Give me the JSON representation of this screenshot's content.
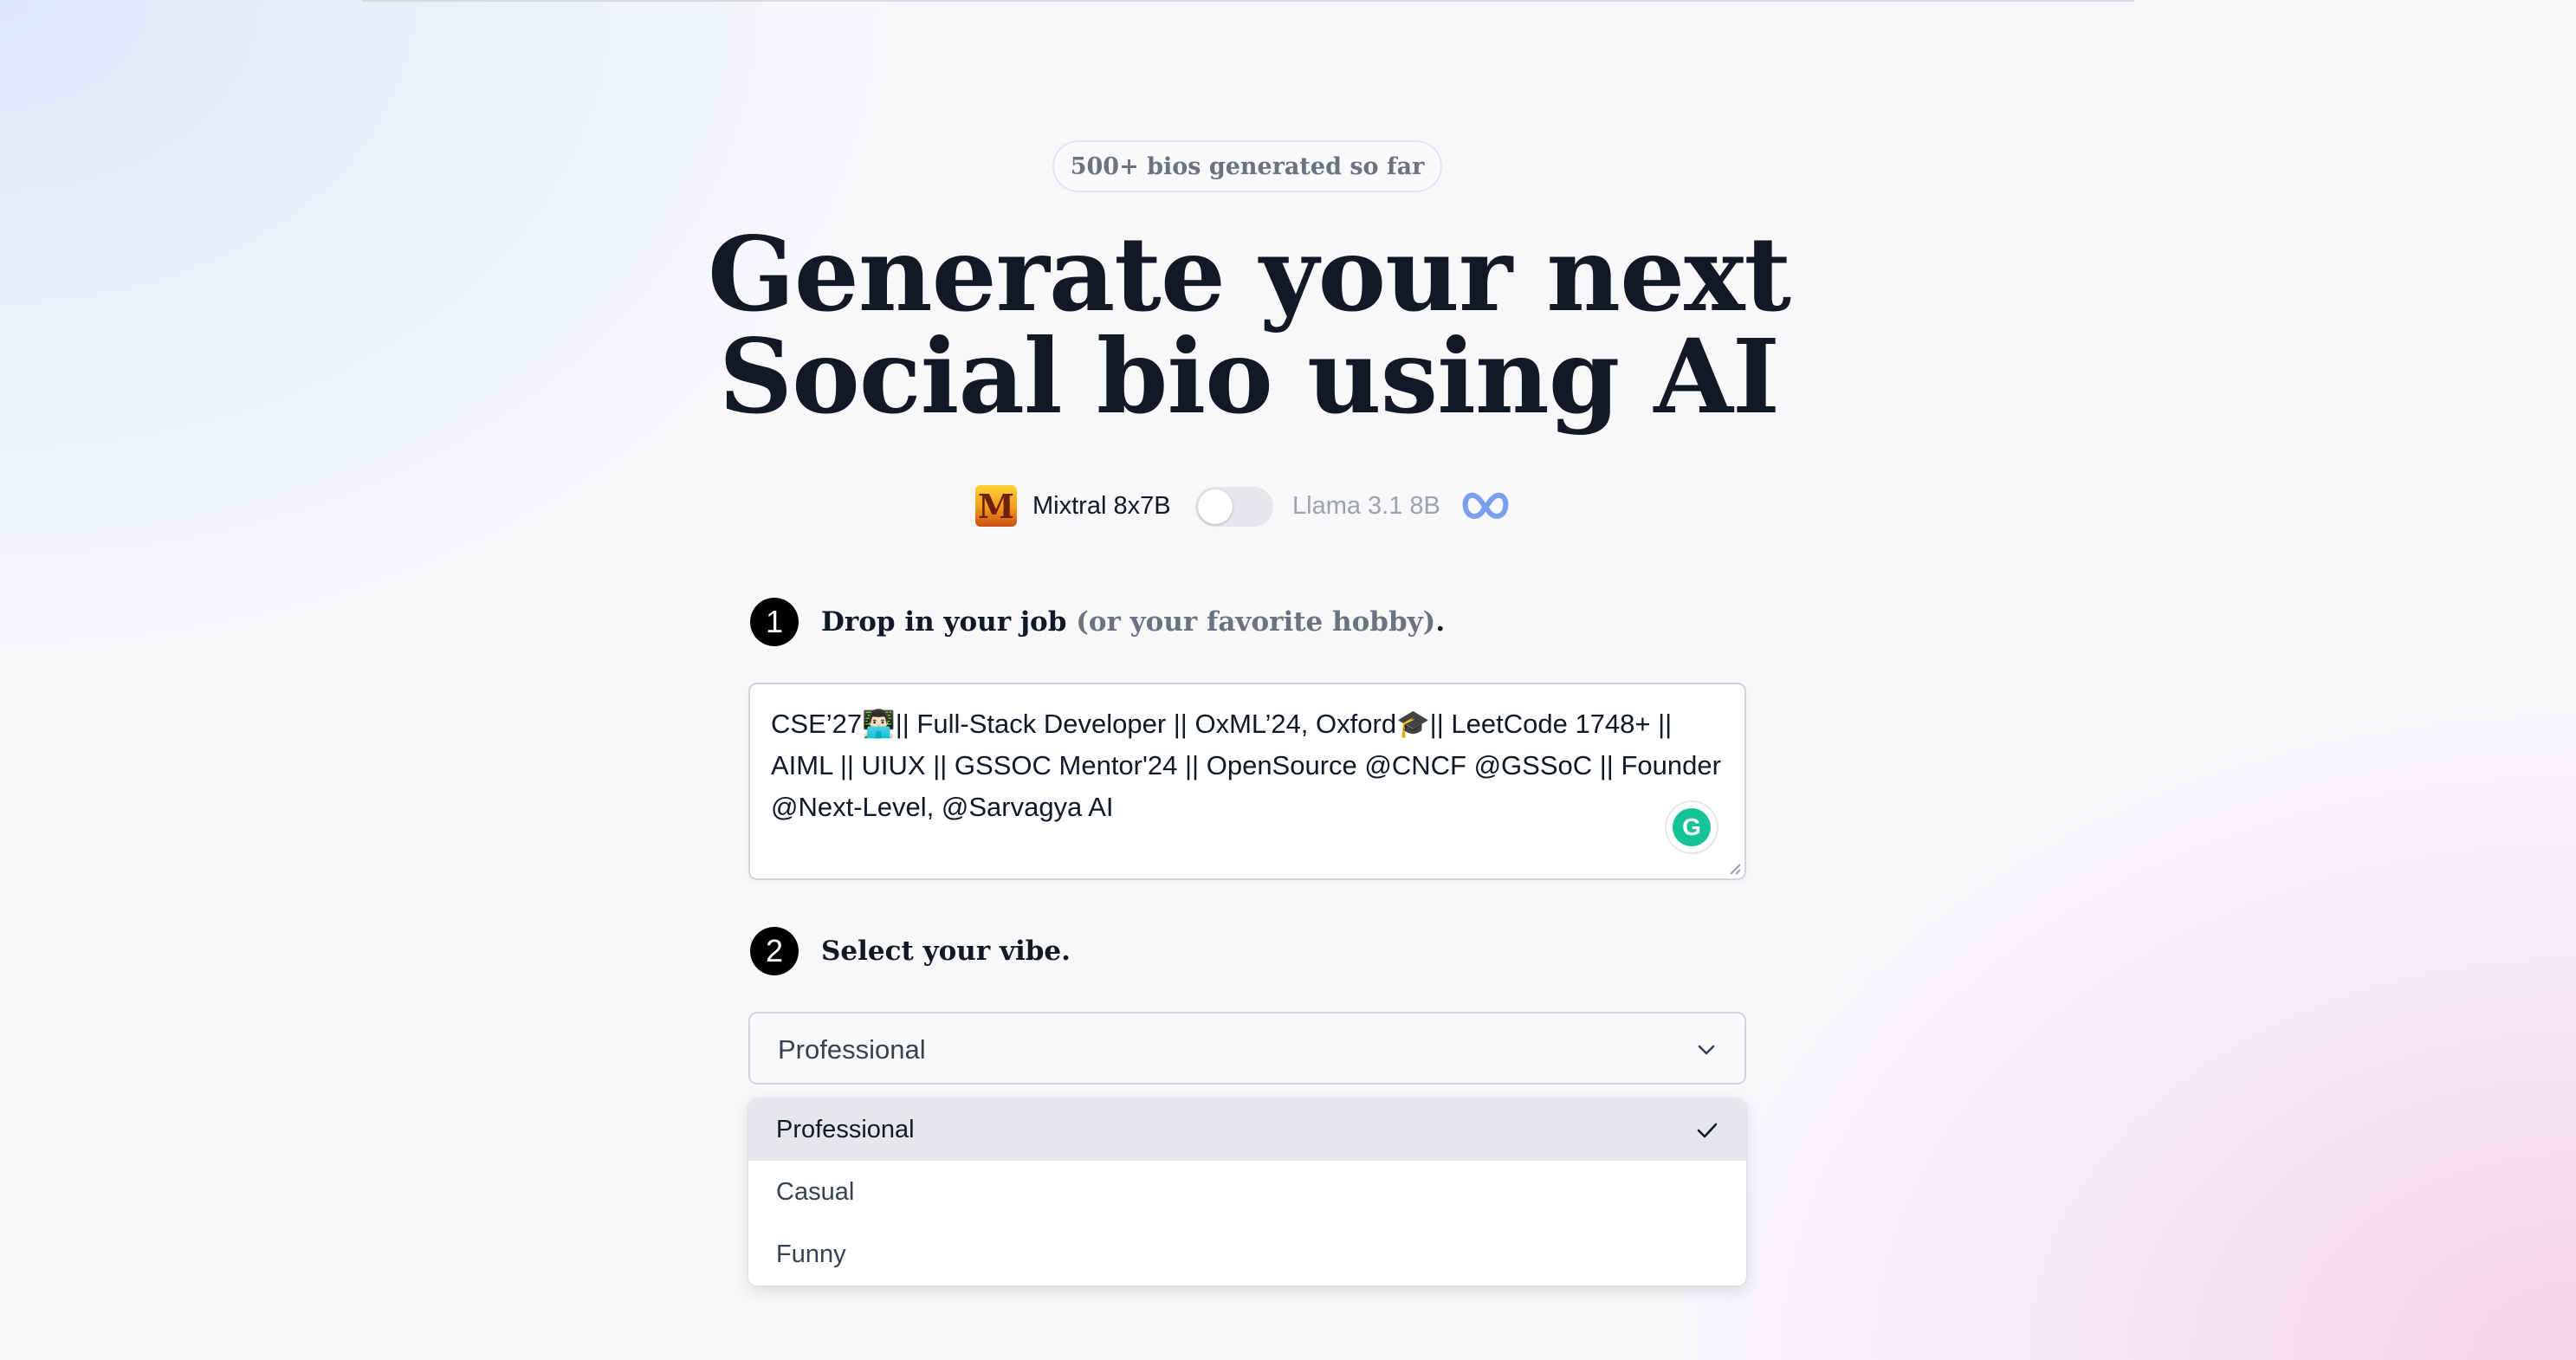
{
  "banner": {
    "text": "500+ bios generated so far"
  },
  "headline": {
    "line1": "Generate your next",
    "line2": "Social bio using AI"
  },
  "model_switch": {
    "left_label": "Mixtral 8x7B",
    "left_logo_letter": "M",
    "right_label": "Llama 3.1 8B",
    "left_icon": "mixtral-logo-icon",
    "right_icon": "meta-logo-icon",
    "selected": "Mixtral 8x7B"
  },
  "step1": {
    "number": "1",
    "label": "Drop in your job",
    "hint": "(or your favorite hobby)",
    "suffix": ".",
    "input_value": "CSE’27👨🏻‍💻|| Full-Stack Developer || OxML’24, Oxford🎓|| LeetCode 1748+ || AIML || UIUX || GSSOC Mentor'24 || OpenSource @CNCF @GSSoC || Founder @Next-Level, @Sarvagya AI",
    "extension_icon": "grammarly-icon",
    "extension_letter": "G"
  },
  "step2": {
    "number": "2",
    "label": "Select your vibe.",
    "selected_value": "Professional",
    "options": [
      "Professional",
      "Casual",
      "Funny"
    ]
  },
  "colors": {
    "text_dark": "#111827",
    "muted": "#6b7280",
    "meta_blue": "#7c9ef0"
  }
}
